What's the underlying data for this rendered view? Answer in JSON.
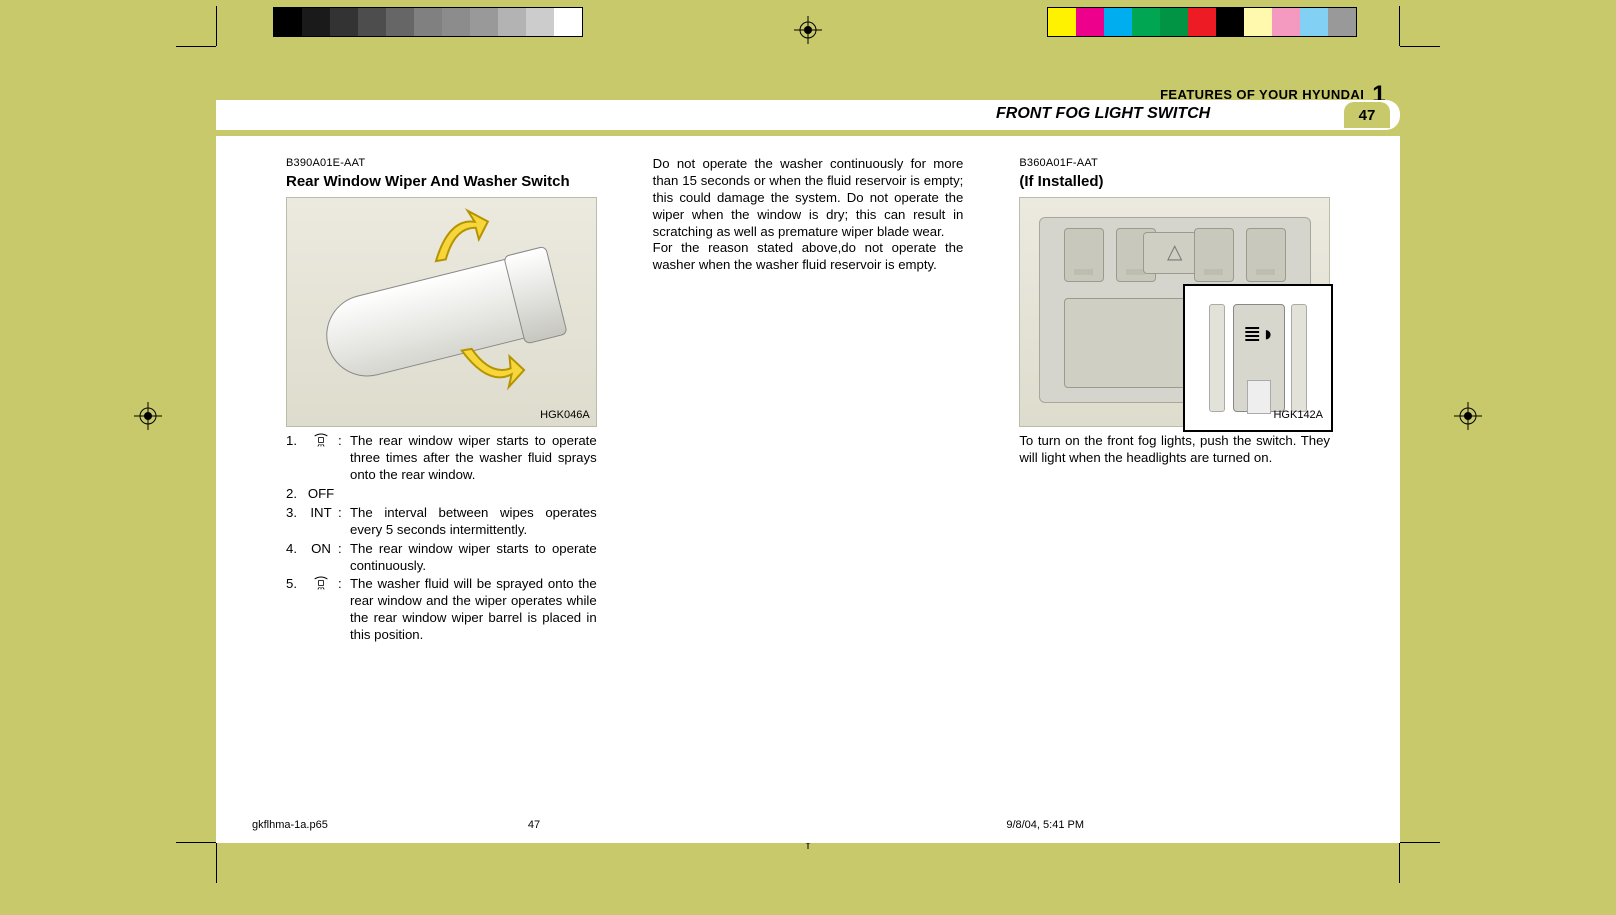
{
  "header": {
    "book_section": "FEATURES OF YOUR HYUNDAI",
    "chapter_num": "1",
    "section_title": "FRONT FOG LIGHT SWITCH",
    "page_num": "47"
  },
  "col1": {
    "code": "B390A01E-AAT",
    "title": "Rear Window Wiper And Washer Switch",
    "fig_label": "HGK046A",
    "items": [
      {
        "num": "1.",
        "sym": "wash",
        "text": "The rear window wiper starts to operate three times after the washer fluid sprays onto the rear window."
      },
      {
        "num": "2.",
        "sym_text": "OFF",
        "text": ""
      },
      {
        "num": "3.",
        "sym_text": "INT",
        "text": "The interval between wipes operates every 5 seconds intermittently."
      },
      {
        "num": "4.",
        "sym_text": "ON",
        "text": "The rear window wiper starts to operate continuously."
      },
      {
        "num": "5.",
        "sym": "wash",
        "text": "The washer fluid will be sprayed onto the rear window and the wiper operates while the rear window wiper barrel is placed in this position."
      }
    ]
  },
  "col2": {
    "para": "Do not operate the washer continuously for more than 15 seconds or when the fluid reservoir is empty; this could damage the system. Do not operate the wiper when the window is dry; this can result in scratching as well as premature wiper blade wear.\nFor the reason stated above,do not operate the washer when the washer fluid reservoir is empty."
  },
  "col3": {
    "code": "B360A01F-AAT",
    "title": "(If Installed)",
    "fig_label": "HGK142A",
    "para": "To turn on the front fog lights, push the switch. They will light when the headlights are turned on."
  },
  "footer": {
    "file": "gkflhma-1a.p65",
    "page": "47",
    "datetime": "9/8/04, 5:41 PM"
  },
  "print_marks": {
    "gray_steps": [
      "#000000",
      "#1a1a1a",
      "#333333",
      "#4d4d4d",
      "#666666",
      "#808080",
      "#8c8c8c",
      "#999999",
      "#b3b3b3",
      "#cccccc",
      "#ffffff"
    ],
    "color_steps": [
      "#fff200",
      "#ec008c",
      "#00aeef",
      "#00a651",
      "#009444",
      "#ed1c24",
      "#000000",
      "#fff9ae",
      "#f49ac1",
      "#83d0f5",
      "#999999"
    ]
  }
}
